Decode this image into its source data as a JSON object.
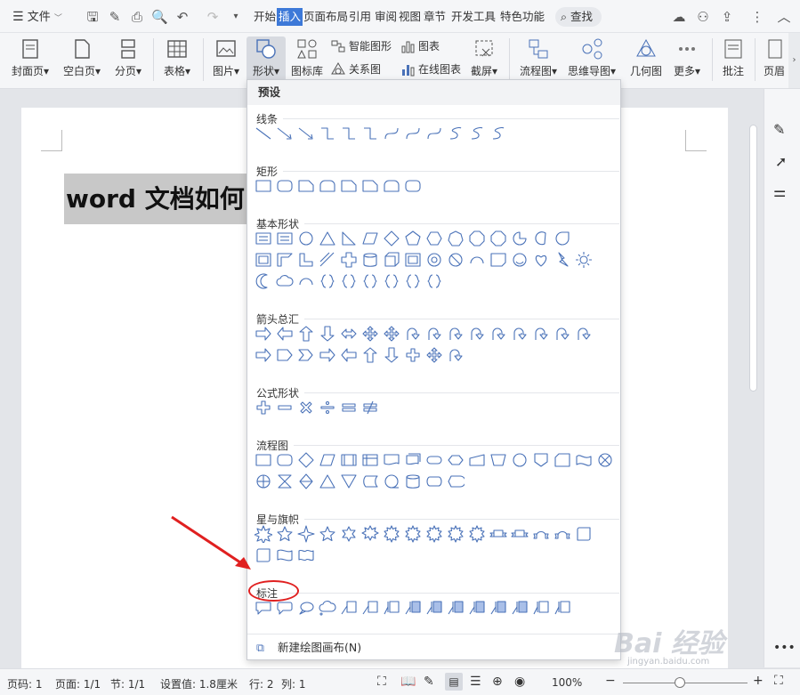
{
  "menubar": {
    "file_label": "文件",
    "tabs": [
      "开始",
      "插入",
      "页面布局",
      "引用",
      "审阅",
      "视图",
      "章节",
      "开发工具",
      "特色功能"
    ],
    "active_tab": "插入",
    "search_label": "查找"
  },
  "ribbon": {
    "cover": "封面页",
    "blank": "空白页",
    "page_break": "分页",
    "table": "表格",
    "picture": "图片",
    "shape": "形状",
    "icon_lib": "图标库",
    "smart_shape": "智能图形",
    "chart": "图表",
    "relation": "关系图",
    "online_chart": "在线图表",
    "screenshot": "截屏",
    "flowchart": "流程图",
    "mindmap": "思维导图",
    "geometry": "几何图",
    "more": "更多",
    "comment": "批注",
    "header_footer": "页眉"
  },
  "document": {
    "title_text": "word 文档如何"
  },
  "dropdown": {
    "header": "预设",
    "categories": {
      "lines": "线条",
      "rects": "矩形",
      "basic": "基本形状",
      "arrows": "箭头总汇",
      "equation": "公式形状",
      "flow": "流程图",
      "stars": "星与旗帜",
      "callouts": "标注"
    },
    "footer": "新建绘图画布(N)"
  },
  "statusbar": {
    "page_num": "页码: 1",
    "pages": "页面: 1/1",
    "section": "节: 1/1",
    "setting": "设置值: 1.8厘米",
    "row": "行: 2",
    "col": "列: 1",
    "zoom": "100%"
  },
  "watermark": {
    "text": "Bai 经验",
    "sub": "jingyan.baidu.com"
  },
  "colors": {
    "accent": "#3d79d8",
    "shape_stroke": "#4a72b8",
    "annotation_red": "#e02020"
  }
}
